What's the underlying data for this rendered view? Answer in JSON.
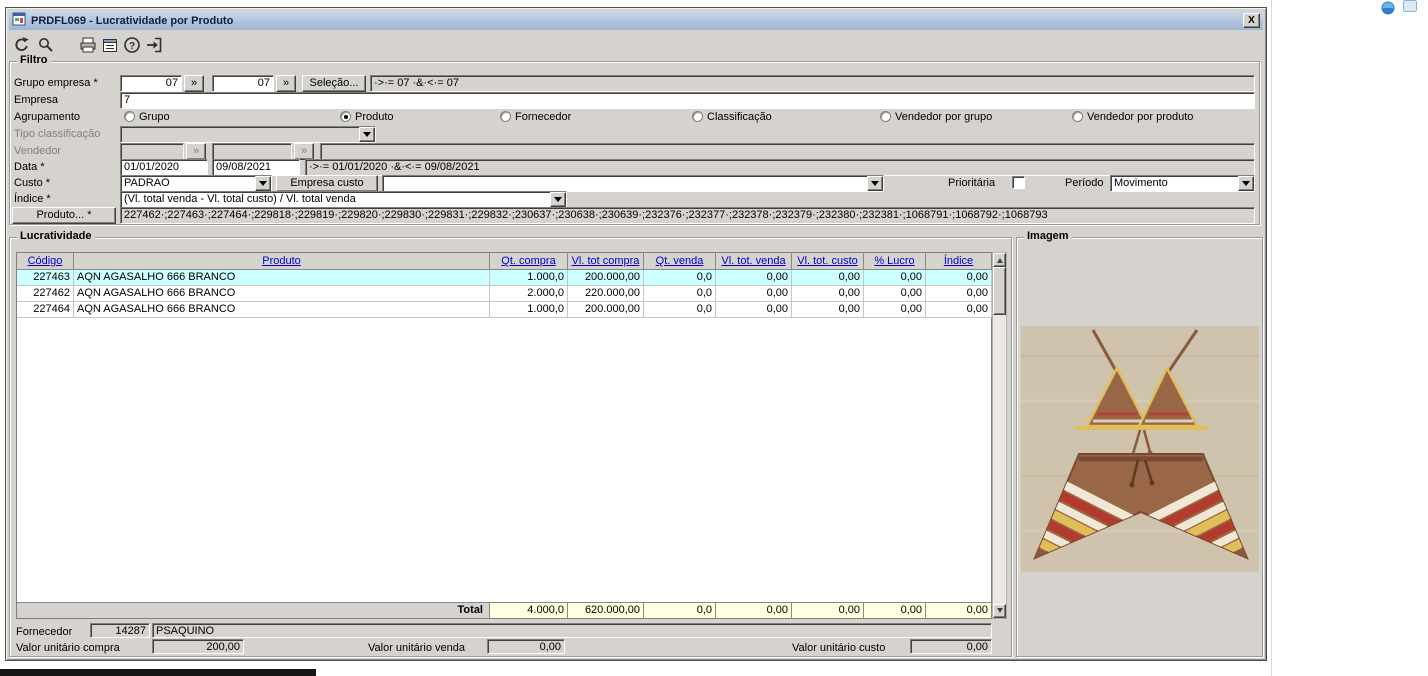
{
  "window": {
    "title": "PRDFL069 - Lucratividade por Produto",
    "close": "X"
  },
  "toolbar": {
    "icons": [
      "undo-icon",
      "search-icon",
      "print-icon",
      "calendar-icon",
      "help-icon",
      "exit-icon"
    ]
  },
  "filtro": {
    "legend": "Filtro",
    "grupo_empresa_label": "Grupo empresa *",
    "grupo_empresa_from": "07",
    "grupo_empresa_to": "07",
    "more_label": "»",
    "selecao_button": "Seleção...",
    "grupo_empresa_range": "·>·= 07  ·&·<·= 07",
    "empresa_label": "Empresa",
    "empresa_value": "7",
    "agrupamento_label": "Agrupamento",
    "agrupamento_options": [
      {
        "label": "Grupo",
        "selected": false
      },
      {
        "label": "Produto",
        "selected": true
      },
      {
        "label": "Fornecedor",
        "selected": false
      },
      {
        "label": "Classificação",
        "selected": false
      },
      {
        "label": "Vendedor por grupo",
        "selected": false
      },
      {
        "label": "Vendedor por produto",
        "selected": false
      }
    ],
    "tipo_classificacao_label": "Tipo classificação",
    "tipo_classificacao_value": "",
    "vendedor_label": "Vendedor",
    "vendedor_from": "",
    "vendedor_to": "",
    "data_label": "Data *",
    "data_from": "01/01/2020",
    "data_to": "09/08/2021",
    "data_range": "·>·= 01/01/2020  ·&·<·= 09/08/2021",
    "custo_label": "Custo *",
    "custo_value": "PADRAO",
    "empresa_custo_button": "Empresa custo",
    "custo_empresa_value": "",
    "prioritaria_label": "Prioritária",
    "prioritaria_checked": false,
    "periodo_label": "Período",
    "periodo_value": "Movimento",
    "indice_label": "Índice *",
    "indice_value": "(Vl. total venda - Vl. total custo) / Vl. total venda",
    "produto_button": "Produto... *",
    "produto_value": "227462·;227463·;227464·;229818·;229819·;229820·;229830·;229831·;229832·;230637·;230638·;230639·;232376·;232377·;232378·;232379·;232380·;232381·;1068791·;1068792·;1068793"
  },
  "lucratividade": {
    "legend": "Lucratividade",
    "columns": [
      "Código",
      "Produto",
      "Qt. compra",
      "Vl. tot compra",
      "Qt. venda",
      "Vl. tot. venda",
      "Vl. tot. custo",
      "% Lucro",
      "Índice"
    ],
    "rows": [
      [
        "227463",
        "AQN AGASALHO 666 BRANCO",
        "1.000,0",
        "200.000,00",
        "0,0",
        "0,00",
        "0,00",
        "0,00",
        "0,00"
      ],
      [
        "227462",
        "AQN AGASALHO 666 BRANCO",
        "2.000,0",
        "220.000,00",
        "0,0",
        "0,00",
        "0,00",
        "0,00",
        "0,00"
      ],
      [
        "227464",
        "AQN AGASALHO 666 BRANCO",
        "1.000,0",
        "200.000,00",
        "0,0",
        "0,00",
        "0,00",
        "0,00",
        "0,00"
      ]
    ],
    "total_label": "Total",
    "totals": [
      "4.000,0",
      "620.000,00",
      "0,0",
      "0,00",
      "0,00",
      "0,00",
      "0,00"
    ],
    "fornecedor_label": "Fornecedor",
    "fornecedor_code": "14287",
    "fornecedor_name": "PSAQUINO",
    "vu_compra_label": "Valor unitário compra",
    "vu_compra": "200,00",
    "vu_venda_label": "Valor unitário venda",
    "vu_venda": "0,00",
    "vu_custo_label": "Valor unitário custo",
    "vu_custo": "0,00"
  },
  "imagem": {
    "legend": "Imagem",
    "photo": "crochet-top-and-shorts-photo"
  }
}
